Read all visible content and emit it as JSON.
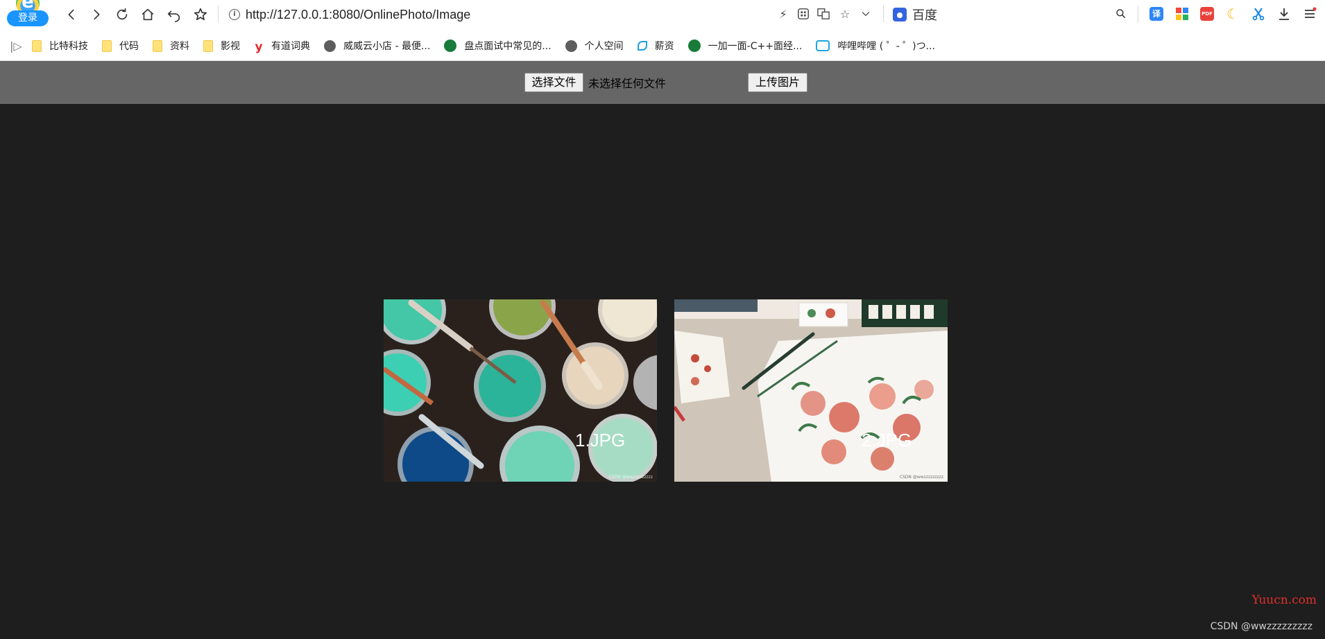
{
  "browser": {
    "login_label": "登录",
    "url": "http://127.0.0.1:8080/OnlinePhoto/Image",
    "search_engine": "百度",
    "icons": [
      "back-icon",
      "forward-icon",
      "reload-icon",
      "home-icon",
      "undo-icon",
      "star-icon",
      "info-icon",
      "lightning-icon",
      "apps-icon",
      "translate-icon",
      "favorite-icon",
      "chevron-down-icon",
      "search-icon",
      "translate-ext-icon",
      "grid-ext-icon",
      "pdf-icon",
      "moon-icon",
      "scissors-icon",
      "download-icon",
      "menu-icon"
    ],
    "ext_labels": {
      "translate": "译",
      "pdf": "PDF"
    }
  },
  "bookmarks": [
    {
      "label": "比特科技",
      "icon": "folder-icon"
    },
    {
      "label": "代码",
      "icon": "folder-icon"
    },
    {
      "label": "资料",
      "icon": "folder-icon"
    },
    {
      "label": "影视",
      "icon": "folder-icon"
    },
    {
      "label": "有道词典",
      "icon": "youdao-icon"
    },
    {
      "label": "威威云小店 - 最便...",
      "icon": "globe-icon"
    },
    {
      "label": "盘点面试中常见的...",
      "icon": "shield-icon"
    },
    {
      "label": "个人空间",
      "icon": "globe-icon"
    },
    {
      "label": "薪资",
      "icon": "leaf-icon"
    },
    {
      "label": "一加一面-C++面经...",
      "icon": "shield-icon"
    },
    {
      "label": "哔哩哔哩 ( ゜- ゜)つ...",
      "icon": "bilibili-icon"
    }
  ],
  "upload": {
    "choose_file_label": "选择文件",
    "file_status": "未选择任何文件",
    "upload_label": "上传图片"
  },
  "gallery": [
    {
      "name": "1.JPG",
      "watermark": "CSDN @wwzzzzzzzzz"
    },
    {
      "name": "2.JPG",
      "watermark": "CSDN @wwzzzzzzzzz"
    }
  ],
  "watermarks": {
    "site": "Yuucn.com",
    "author": "CSDN @wwzzzzzzzzz"
  },
  "colors": {
    "page_background": "#1e1e1e",
    "upload_bar": "#666666",
    "accent_red": "#e0302b"
  }
}
